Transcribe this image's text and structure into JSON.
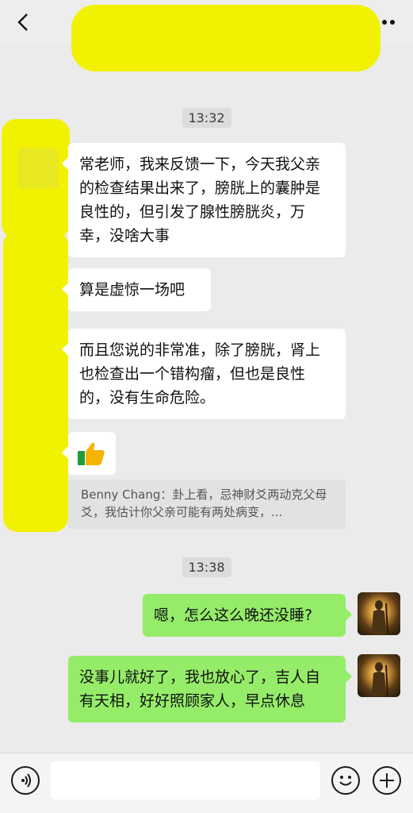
{
  "header": {
    "back_icon": "chevron-left-icon",
    "more_icon": "ellipsis-icon"
  },
  "messages": {
    "time1": "13:32",
    "m1": "常老师，我来反馈一下，今天我父亲的检查结果出来了，膀胱上的囊肿是良性的，但引发了腺性膀胱炎，万幸，没啥大事",
    "m2": "算是虚惊一场吧",
    "m3": "而且您说的非常准，除了膀胱，肾上也检查出一个错构瘤，但也是良性的，没有生命危险。",
    "m4_icon": "thumbs-up-emoji",
    "quote": "Benny Chang：卦上看，忌神财爻两动克父母爻，我估计你父亲可能有两处病变，...",
    "time2": "13:38",
    "m5": "嗯，怎么这么晚还没睡?",
    "m6": "没事儿就好了，我也放心了，吉人自有天相，好好照顾家人，早点休息"
  },
  "input_bar": {
    "voice_icon": "voice-icon",
    "emoji_icon": "emoji-icon",
    "plus_icon": "plus-icon",
    "input_value": ""
  },
  "colors": {
    "background": "#ebebeb",
    "self_bubble": "#95ec69",
    "other_bubble": "#ffffff",
    "redaction": "#f2f200"
  }
}
